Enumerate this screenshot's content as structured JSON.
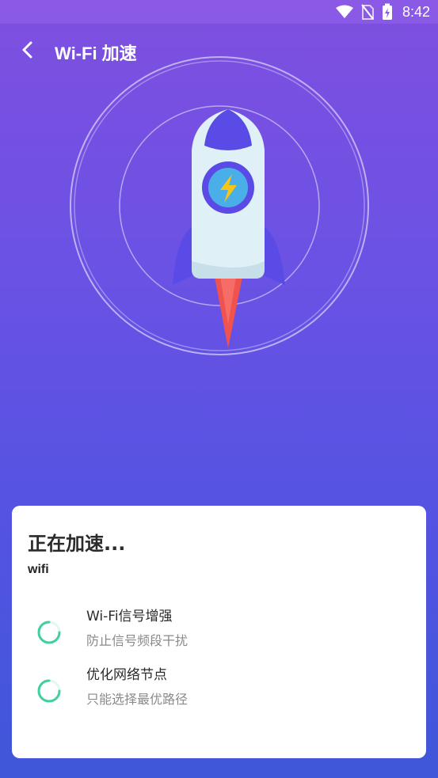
{
  "status_bar": {
    "time": "8:42",
    "icons": [
      "wifi-icon",
      "no-sim-icon",
      "battery-charging-icon"
    ]
  },
  "header": {
    "back_icon": "chevron-left-icon",
    "title": "Wi-Fi 加速"
  },
  "hero": {
    "icon": "rocket-icon",
    "badge_icon": "lightning-icon"
  },
  "card": {
    "title": "正在加速...",
    "network_name": "wifi",
    "tasks": [
      {
        "title": "Wi-Fi信号增强",
        "desc": "防止信号频段干扰",
        "status_icon": "loading-spinner-icon"
      },
      {
        "title": "优化网络节点",
        "desc": "只能选择最优路径",
        "status_icon": "loading-spinner-icon"
      }
    ]
  },
  "colors": {
    "bg_top": "#7f4fe0",
    "bg_bottom": "#3f57d9",
    "spinner": "#3fcfa0",
    "rocket_body": "#dff1f6",
    "rocket_accent": "#5b4be6",
    "flame": "#f0524e",
    "bolt": "#f5c518",
    "badge": "#4aaee8"
  }
}
